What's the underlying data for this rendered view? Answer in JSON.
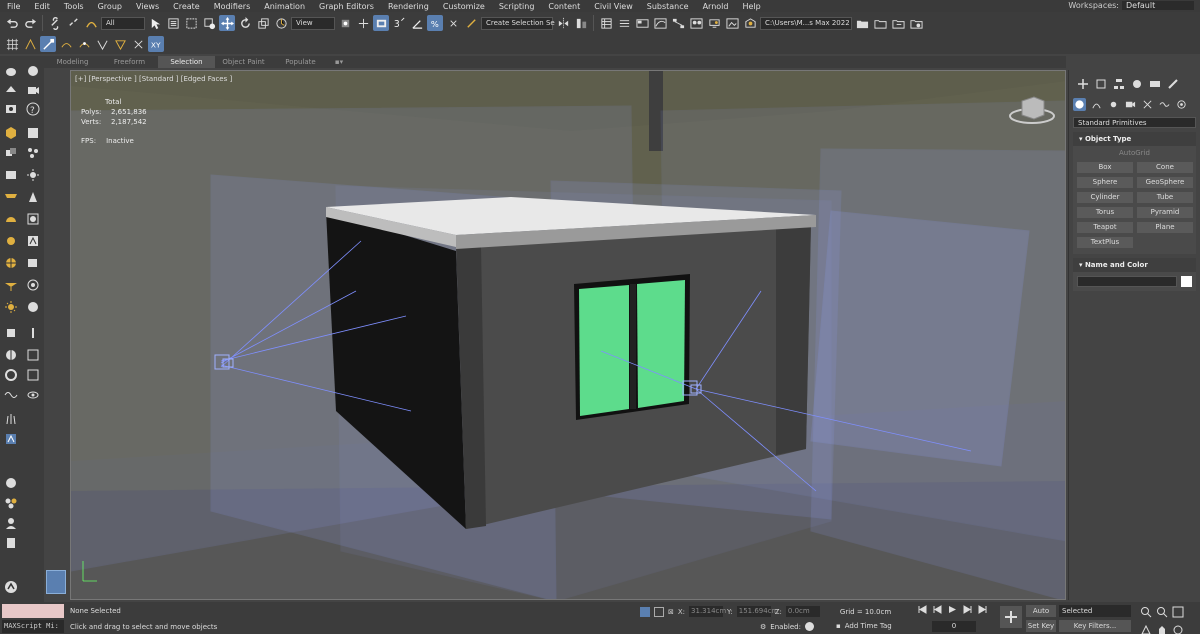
{
  "menu": [
    "File",
    "Edit",
    "Tools",
    "Group",
    "Views",
    "Create",
    "Modifiers",
    "Animation",
    "Graph Editors",
    "Rendering",
    "Customize",
    "Scripting",
    "Content",
    "Civil View",
    "Substance",
    "Arnold",
    "Help"
  ],
  "workspaces": {
    "label": "Workspaces:",
    "value": "Default"
  },
  "toolbar": {
    "filter_value": "All",
    "refcoord_value": "View",
    "selection_set_value": "Create Selection Se",
    "project_path": "C:\\Users\\M...s Max 2022"
  },
  "ribbon_tabs": [
    "Modeling",
    "Freeform",
    "Selection",
    "Object Paint",
    "Populate"
  ],
  "viewport": {
    "label": "[+] [Perspective ] [Standard ] [Edged Faces ]",
    "stats": {
      "total_label": "Total",
      "polys_label": "Polys:",
      "polys_value": "2,651,836",
      "verts_label": "Verts:",
      "verts_value": "2,187,542"
    },
    "fps_label": "FPS:",
    "fps_value": "Inactive"
  },
  "command_panel": {
    "category_dropdown": "Standard Primitives",
    "object_type_header": "Object Type",
    "autogrid_label": "AutoGrid",
    "primitives": [
      "Box",
      "Cone",
      "Sphere",
      "GeoSphere",
      "Cylinder",
      "Tube",
      "Torus",
      "Pyramid",
      "Teapot",
      "Plane",
      "TextPlus"
    ],
    "name_color_header": "Name and Color"
  },
  "status": {
    "maxscript_label": "MAXScript Mi:",
    "selection_text": "None Selected",
    "prompt_text": "Click and drag to select and move objects",
    "x_label": "X:",
    "x_value": "31.314cm",
    "y_label": "Y:",
    "y_value": "151.694cm",
    "z_label": "Z:",
    "z_value": "0.0cm",
    "grid_text": "Grid = 10.0cm",
    "enabled_label": "Enabled:",
    "time_tag_label": "Add Time Tag",
    "frame_value": "0",
    "auto_key_label": "Auto Key",
    "auto_key_value": "Selected",
    "set_key_label": "Set Key",
    "key_filters_label": "Key Filters..."
  },
  "colors": {
    "accent": "#5a7fb0",
    "window_glass": "#5ddc8c",
    "light_plane": "#9aa8ff"
  }
}
